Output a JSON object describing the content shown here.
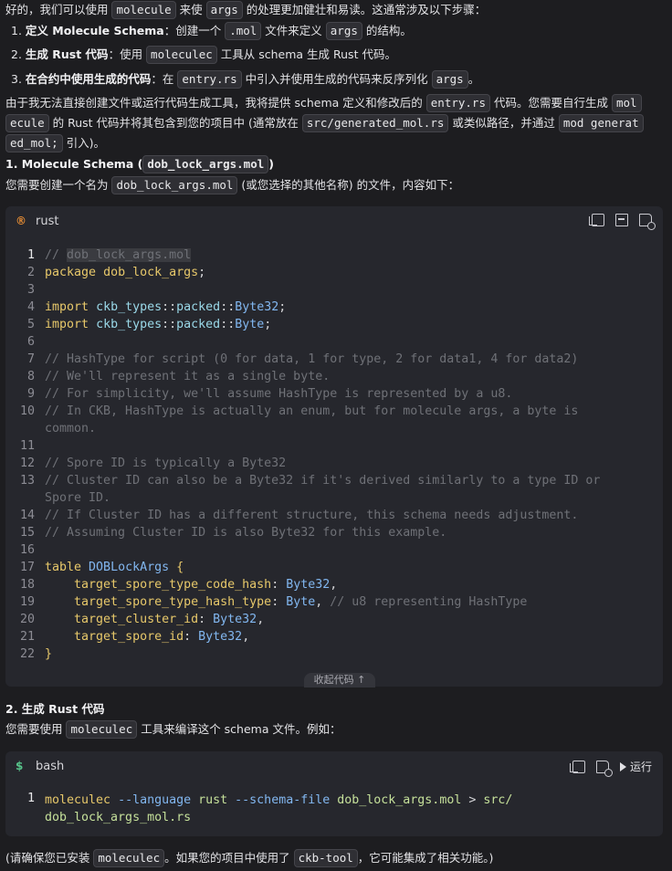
{
  "intro": {
    "line1": [
      "好的，我们可以使用 ",
      "molecule",
      " 来使 ",
      "args",
      " 的处理更加健壮和易读。这通常涉及以下步骤："
    ],
    "step1": [
      "1. ",
      "定义 Molecule Schema",
      "：创建一个 ",
      ".mol",
      " 文件来定义 ",
      "args",
      " 的结构。"
    ],
    "step2": [
      "2. ",
      "生成 Rust 代码",
      "：使用 ",
      "moleculec",
      " 工具从 schema 生成 Rust 代码。"
    ],
    "step3": [
      "3. ",
      "在合约中使用生成的代码",
      "：在 ",
      "entry.rs",
      " 中引入并使用生成的代码来反序列化 ",
      "args",
      "。"
    ],
    "para1": [
      "由于我无法直接创建文件或运行代码生成工具，我将提供 schema 定义和修改后的 ",
      "entry.rs",
      " 代码。您需要自行生成 ",
      "mol"
    ],
    "para2": [
      "ecule",
      " 的 Rust 代码并将其包含到您的项目中 (通常放在 ",
      "src/generated_mol.rs",
      " 或类似路径，并通过 ",
      "mod generat"
    ],
    "para3": [
      "ed_mol;",
      " 引入)。"
    ]
  },
  "section1": {
    "heading": [
      "1. Molecule Schema (",
      "dob_lock_args.mol",
      ")"
    ],
    "desc": [
      "您需要创建一个名为 ",
      "dob_lock_args.mol",
      " (或您选择的其他名称) 的文件，内容如下："
    ]
  },
  "rust_block": {
    "lang_icon": "®",
    "lang": "rust",
    "collapse_label": "收起代码 ↑",
    "lines": [
      {
        "n": "1",
        "text": "// dob_lock_args.mol"
      },
      {
        "n": "2",
        "text": "package dob_lock_args;"
      },
      {
        "n": "3",
        "text": ""
      },
      {
        "n": "4",
        "text": "import ckb_types::packed::Byte32;"
      },
      {
        "n": "5",
        "text": "import ckb_types::packed::Byte;"
      },
      {
        "n": "6",
        "text": ""
      },
      {
        "n": "7",
        "text": "// HashType for script (0 for data, 1 for type, 2 for data1, 4 for data2)"
      },
      {
        "n": "8",
        "text": "// We'll represent it as a single byte."
      },
      {
        "n": "9",
        "text": "// For simplicity, we'll assume HashType is represented by a u8."
      },
      {
        "n": "10",
        "text": "// In CKB, HashType is actually an enum, but for molecule args, a byte is"
      },
      {
        "n": "",
        "text": "common."
      },
      {
        "n": "11",
        "text": ""
      },
      {
        "n": "12",
        "text": "// Spore ID is typically a Byte32"
      },
      {
        "n": "13",
        "text": "// Cluster ID can also be a Byte32 if it's derived similarly to a type ID or"
      },
      {
        "n": "",
        "text": "Spore ID."
      },
      {
        "n": "14",
        "text": "// If Cluster ID has a different structure, this schema needs adjustment."
      },
      {
        "n": "15",
        "text": "// Assuming Cluster ID is also Byte32 for this example."
      },
      {
        "n": "16",
        "text": ""
      },
      {
        "n": "17",
        "text": "table DOBLockArgs {"
      },
      {
        "n": "18",
        "text": "    target_spore_type_code_hash: Byte32,"
      },
      {
        "n": "19",
        "text": "    target_spore_type_hash_type: Byte, // u8 representing HashType"
      },
      {
        "n": "20",
        "text": "    target_cluster_id: Byte32,"
      },
      {
        "n": "21",
        "text": "    target_spore_id: Byte32,"
      },
      {
        "n": "22",
        "text": "}"
      }
    ]
  },
  "section2": {
    "heading": "2. 生成 Rust 代码",
    "desc": [
      "您需要使用 ",
      "moleculec",
      " 工具来编译这个 schema 文件。例如："
    ]
  },
  "bash_block": {
    "lang_icon": "$",
    "lang": "bash",
    "run_label": "运行",
    "line_number": "1",
    "line1": [
      "moleculec",
      " --language",
      " rust",
      " --schema-file",
      " dob_lock_args.mol",
      " >",
      " src/"
    ],
    "line2": "dob_lock_args_mol.rs"
  },
  "footer": [
    "(请确保您已安装 ",
    "moleculec",
    "。如果您的项目中使用了 ",
    "ckb-tool",
    "，它可能集成了相关功能。)"
  ],
  "colors": {
    "background": "#1d1d20",
    "code_bg": "#26272d",
    "keyword": "#e7c86a",
    "type": "#82b7f0",
    "comment": "#6f7177"
  }
}
